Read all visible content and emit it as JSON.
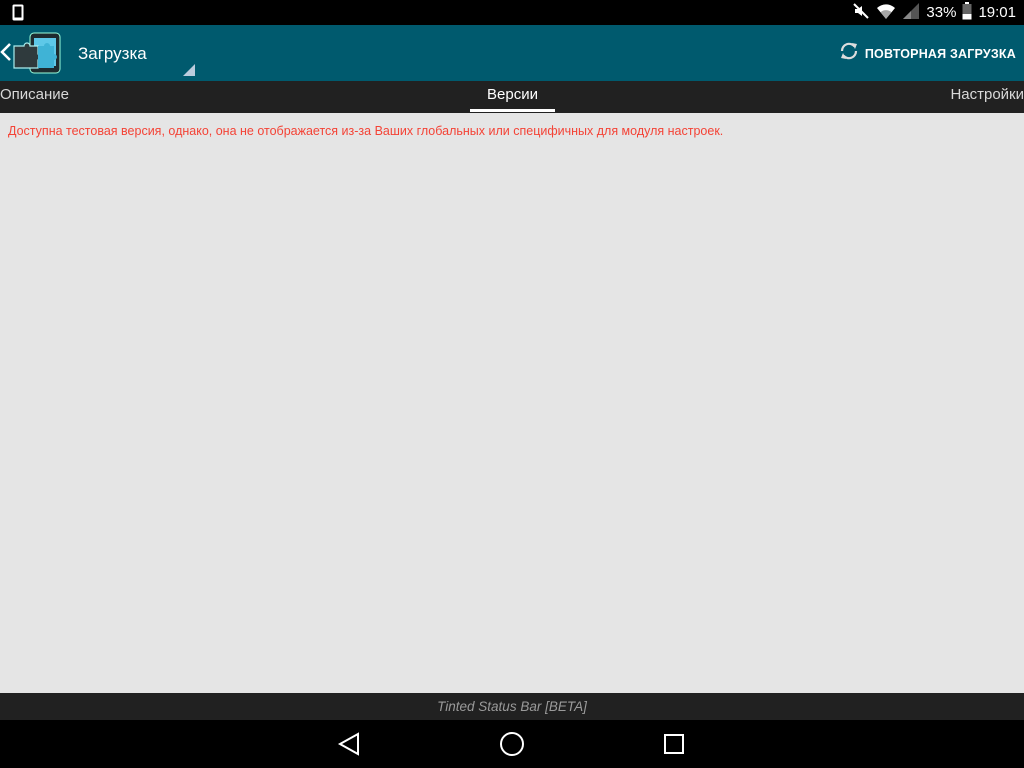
{
  "status_bar": {
    "battery": "33%",
    "time": "19:01",
    "icons": [
      "tablet-icon",
      "mute-icon",
      "wifi-icon",
      "signal-icon",
      "battery-icon"
    ]
  },
  "action_bar": {
    "title": "Загрузка",
    "retry_label": "ПОВТОРНАЯ ЗАГРУЗКА",
    "background_color": "#005a6e"
  },
  "tabs": [
    {
      "label": "Описание",
      "selected": false
    },
    {
      "label": "Версии",
      "selected": true
    },
    {
      "label": "Настройки",
      "selected": false
    }
  ],
  "content": {
    "warning": "Доступна тестовая версия, однако, она не отображается из-за Ваших глобальных или специфичных для модуля настроек.",
    "warning_color": "#f44336"
  },
  "info_bar": {
    "text": "Tinted Status Bar [BETA]"
  },
  "nav_bar": {
    "buttons": [
      "back-icon",
      "home-icon",
      "recents-icon"
    ]
  }
}
